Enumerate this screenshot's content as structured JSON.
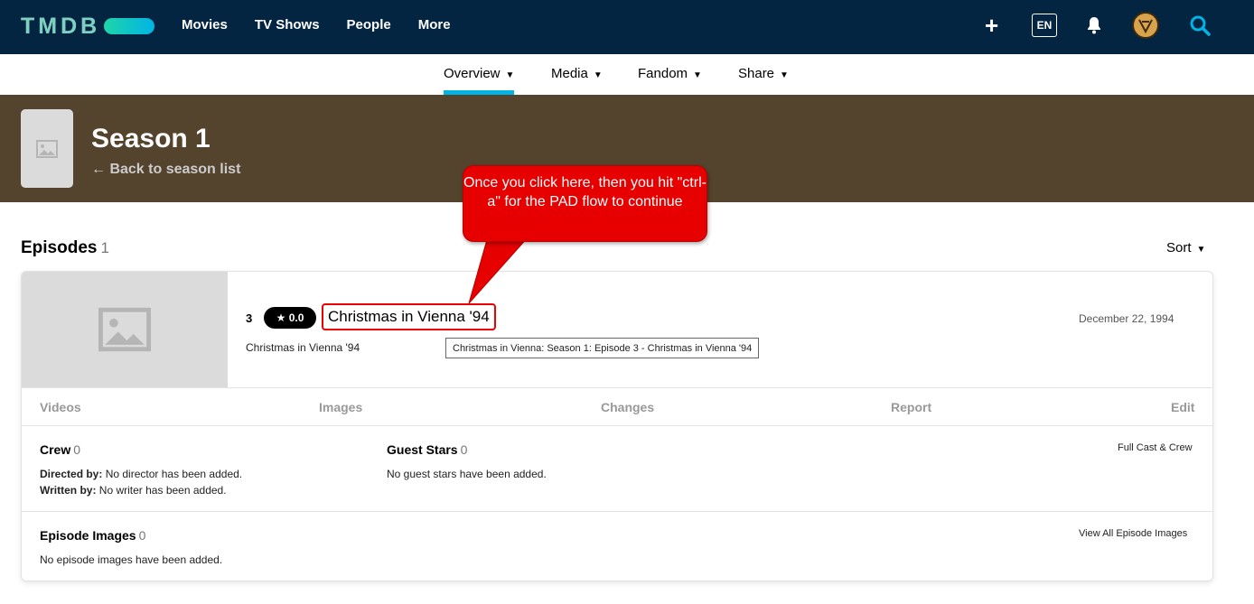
{
  "header": {
    "logo": "TMDB",
    "nav": [
      "Movies",
      "TV Shows",
      "People",
      "More"
    ],
    "lang": "EN"
  },
  "subnav": {
    "items": [
      "Overview",
      "Media",
      "Fandom",
      "Share"
    ],
    "active": "Overview"
  },
  "season": {
    "title": "Season 1",
    "back": "← Back to season list"
  },
  "episodes": {
    "heading": "Episodes",
    "count": "1",
    "sort_label": "Sort"
  },
  "episode": {
    "number": "3",
    "rating": "★ 0.0",
    "title": "Christmas in Vienna '94",
    "air_date": "December 22, 1994",
    "overview": "Christmas in Vienna '94",
    "tooltip": "Christmas in Vienna: Season 1: Episode 3 - Christmas in Vienna '94",
    "actions": [
      "Videos",
      "Images",
      "Changes",
      "Report",
      "Edit"
    ],
    "crew": {
      "title": "Crew",
      "count": "0",
      "directed_label": "Directed by:",
      "directed_value": "No director has been added.",
      "written_label": "Written by:",
      "written_value": "No writer has been added."
    },
    "guest_stars": {
      "title": "Guest Stars",
      "count": "0",
      "empty": "No guest stars have been added."
    },
    "full_cast_link": "Full Cast & Crew",
    "episode_images": {
      "title": "Episode Images",
      "count": "0",
      "empty": "No episode images have been added.",
      "link": "View All Episode Images"
    }
  },
  "callout": {
    "text": "Once you click here, then you hit \"ctrl-a\" for the PAD flow to continue"
  },
  "colors": {
    "header_bg": "#032541",
    "season_bg": "#54432d",
    "accent": "#01b4e4",
    "callout": "#e60000"
  }
}
